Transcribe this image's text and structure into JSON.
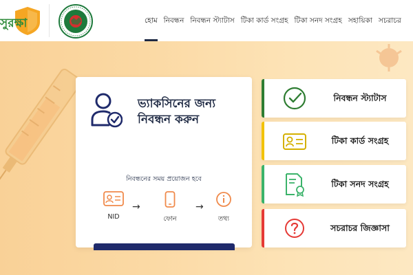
{
  "nav": {
    "items": [
      {
        "label": "হোম",
        "active": true
      },
      {
        "label": "নিবন্ধন",
        "active": false
      },
      {
        "label": "নিবন্ধন স্ট্যাটাস",
        "active": false
      },
      {
        "label": "টিকা কার্ড সংগ্রহ",
        "active": false
      },
      {
        "label": "টিকা সনদ সংগ্রহ",
        "active": false
      },
      {
        "label": "সহায়িকা",
        "active": false
      },
      {
        "label": "সচরাচর",
        "active": false
      }
    ]
  },
  "logo": {
    "brand_text": "সুরক্ষা"
  },
  "registration": {
    "heading_line1": "ভ্যাকসিনের জন্য",
    "heading_line2": "নিবন্ধন করুন",
    "requirements_title": "নিবন্ধনের সময় প্রয়োজন হবে",
    "requirements": [
      {
        "label": "NID",
        "icon": "id-card-icon"
      },
      {
        "label": "ফোন",
        "icon": "phone-icon"
      },
      {
        "label": "তথ্য",
        "icon": "info-icon"
      }
    ]
  },
  "side_cards": [
    {
      "label": "নিবন্ধন স্ট্যাটাস",
      "icon": "check-circle-icon",
      "accent": "#2e7d32"
    },
    {
      "label": "টিকা কার্ড সংগ্রহ",
      "icon": "id-card-icon",
      "accent": "#f2c200"
    },
    {
      "label": "টিকা সনদ সংগ্রহ",
      "icon": "certificate-icon",
      "accent": "#3bb36a"
    },
    {
      "label": "সচরাচর জিজ্ঞাসা",
      "icon": "question-icon",
      "accent": "#e53935"
    }
  ],
  "colors": {
    "brand_green": "#2e7d32",
    "navy": "#1f2a44",
    "orange_icon": "#f08a4b",
    "banner_bg": "#fbd9a4"
  }
}
